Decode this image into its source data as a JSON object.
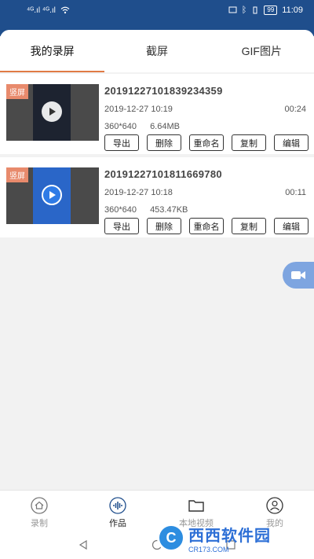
{
  "status_bar": {
    "signal_left": "⁴ᴳ.ıl ⁴ᴳ.ıl",
    "wifi_icon": "wifi-icon",
    "battery": "99",
    "time": "11:09"
  },
  "tabs": [
    {
      "label": "我的录屏"
    },
    {
      "label": "截屏"
    },
    {
      "label": "GIF图片"
    }
  ],
  "recordings": [
    {
      "badge": "竖屏",
      "title": "20191227101839234359",
      "date": "2019-12-27 10:19",
      "duration": "00:24",
      "resolution": "360*640",
      "size": "6.64MB"
    },
    {
      "badge": "竖屏",
      "title": "20191227101811669780",
      "date": "2019-12-27 10:18",
      "duration": "00:11",
      "resolution": "360*640",
      "size": "453.47KB"
    }
  ],
  "actions": {
    "export": "导出",
    "delete": "删除",
    "rename": "重命名",
    "copy": "复制",
    "edit": "编辑"
  },
  "bottom_nav": [
    {
      "label": "录制",
      "icon": "home-icon"
    },
    {
      "label": "作品",
      "icon": "waveform-icon"
    },
    {
      "label": "本地视频",
      "icon": "folder-icon"
    },
    {
      "label": "我的",
      "icon": "user-icon"
    }
  ],
  "watermark": {
    "logo": "C",
    "main": "西西软件园",
    "sub": "CR173.COM"
  },
  "colors": {
    "header": "#1f4e8c",
    "tab_indicator": "#e07b45",
    "badge": "#e88a6c",
    "float_button": "#7ea5e0"
  }
}
